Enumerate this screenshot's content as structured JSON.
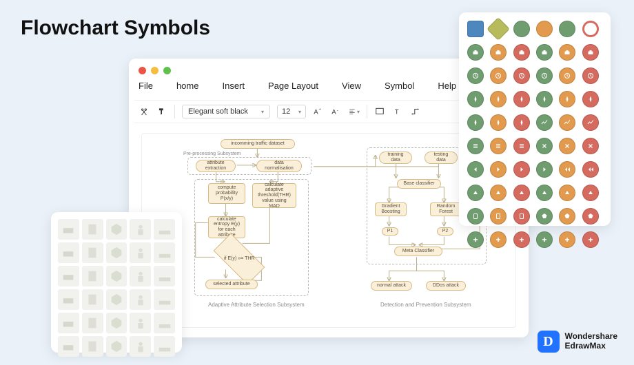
{
  "page_title": "Flowchart Symbols",
  "menubar": [
    "File",
    "home",
    "Insert",
    "Page Layout",
    "View",
    "Symbol",
    "Help"
  ],
  "toolbar": {
    "font_name": "Elegant soft black",
    "font_size": "12"
  },
  "diagram": {
    "preprocessing_label": "Pre-processing Subsystem",
    "caption_left": "Adaptive Attribute Selection Subsystem",
    "caption_right": "Detection and Prevention Subsystem",
    "nodes": {
      "incoming": "incomming traffic dataset",
      "attr_extract": "attribute extraction",
      "data_norm": "data normalisation",
      "compute_prob": "compute probability P(x/y)",
      "calc_thr": "calculate adaptive threshold(THR) value using MAD",
      "calc_entropy": "calculate entropy E(y) for each attribute",
      "decision": "if E(y) »= THR",
      "selected_attr": "selected attribute",
      "training": "training data",
      "testing": "testing data",
      "base_clf": "Base classifier",
      "grad_boost": "Gradient Boosting",
      "rand_forest": "Random Forest",
      "p1": "P1",
      "p2": "P2",
      "meta_clf": "Meta Classifier",
      "normal": "normal attack",
      "ddos": "DDos attack"
    }
  },
  "symbol_palette": {
    "colors": {
      "blue": "#4e86be",
      "olive": "#b7bb5b",
      "green": "#6f9d70",
      "orange": "#e19a4e",
      "red": "#d56a5e"
    },
    "row0": [
      {
        "shape": "roundrect",
        "color": "blue"
      },
      {
        "shape": "diamond",
        "color": "olive"
      },
      {
        "shape": "circle",
        "color": "green"
      },
      {
        "shape": "circle",
        "color": "orange"
      },
      {
        "shape": "circle",
        "color": "green"
      },
      {
        "shape": "ring",
        "color": "red"
      }
    ],
    "icon_rows": [
      [
        "briefcase",
        "briefcase",
        "briefcase",
        "briefcase",
        "briefcase",
        "briefcase"
      ],
      [
        "clock",
        "clock",
        "clock",
        "clock",
        "clock",
        "clock"
      ],
      [
        "compass",
        "compass",
        "compass",
        "compass",
        "compass",
        "compass"
      ],
      [
        "compass",
        "compass",
        "compass",
        "trend",
        "trend",
        "trend"
      ],
      [
        "list",
        "list",
        "list",
        "x",
        "x",
        "x"
      ],
      [
        "arrow-l",
        "arrow-r",
        "arrow-r",
        "arrow-r",
        "rewind",
        "rewind"
      ],
      [
        "tri-up",
        "tri-up",
        "tri-up",
        "tri-up",
        "tri-up",
        "tri-up"
      ],
      [
        "clip",
        "clip",
        "clip",
        "pent",
        "pent",
        "pent"
      ],
      [
        "plus",
        "plus",
        "plus",
        "plus",
        "plus",
        "plus"
      ]
    ],
    "icon_row_color_cycle": [
      "green",
      "orange",
      "red",
      "green",
      "orange",
      "red"
    ]
  },
  "clipart": {
    "count": 30
  },
  "brand": {
    "line1": "Wondershare",
    "line2": "EdrawMax",
    "logo_letter": "D"
  }
}
